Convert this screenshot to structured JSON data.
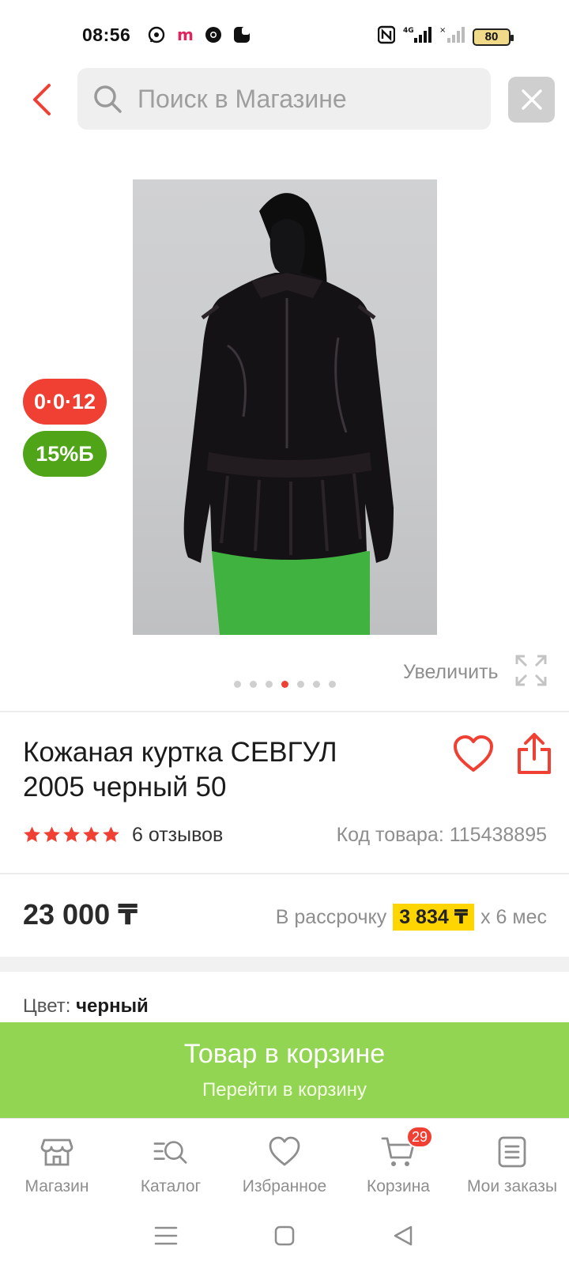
{
  "status_bar": {
    "time": "08:56",
    "battery": "80",
    "network": "4G"
  },
  "search": {
    "placeholder": "Поиск в Магазине"
  },
  "product": {
    "badges": {
      "installment": "0·0·12",
      "bonus": "15%Б"
    },
    "zoom_label": "Увеличить",
    "gallery": {
      "count": 7,
      "active_index": 3
    },
    "title": "Кожаная куртка СЕВГУЛ 2005 черный 50",
    "rating": {
      "stars": 5,
      "reviews_text": "6 отзывов"
    },
    "sku_text": "Код товара: 115438895",
    "price": "23 000 ₸",
    "installment": {
      "prefix": "В рассрочку",
      "amount": "3 834 ₸",
      "suffix": "х 6 мес"
    },
    "color": {
      "label": "Цвет:",
      "value": "черный"
    }
  },
  "cart_banner": {
    "title": "Товар в корзине",
    "link": "Перейти в корзину"
  },
  "bottom_nav": {
    "items": [
      {
        "label": "Магазин",
        "icon": "store-icon"
      },
      {
        "label": "Каталог",
        "icon": "catalog-search-icon"
      },
      {
        "label": "Избранное",
        "icon": "heart-icon"
      },
      {
        "label": "Корзина",
        "icon": "cart-icon",
        "badge": "29"
      },
      {
        "label": "Мои заказы",
        "icon": "orders-icon"
      }
    ]
  },
  "colors": {
    "accent_red": "#ef4033",
    "bonus_green": "#4fa517",
    "banner_green": "#92d552",
    "installment_yellow": "#ffd500"
  }
}
